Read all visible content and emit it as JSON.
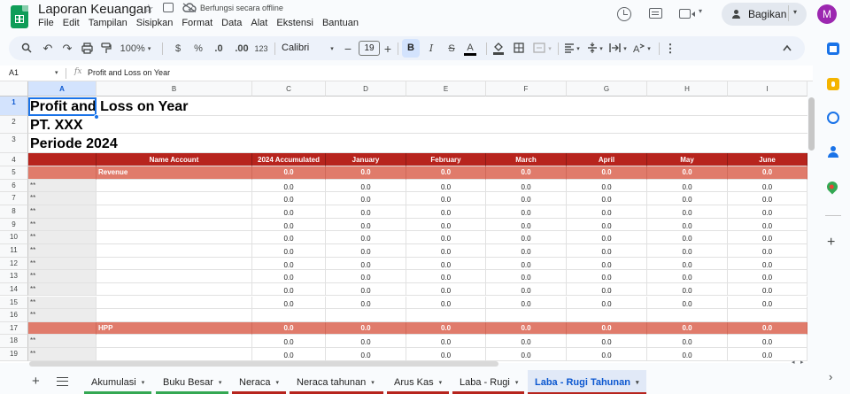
{
  "app": {
    "doc_title": "Laporan Keuangan",
    "offline_status": "Berfungsi secara offline",
    "menu": [
      "File",
      "Edit",
      "Tampilan",
      "Sisipkan",
      "Format",
      "Data",
      "Alat",
      "Ekstensi",
      "Bantuan"
    ],
    "share_label": "Bagikan",
    "avatar_letter": "M"
  },
  "toolbar": {
    "zoom": "100%",
    "currency": "$",
    "percent": "%",
    "dec_decrease": ".0",
    "dec_increase": ".00",
    "number_format": "123",
    "font": "Calibri",
    "font_size": "19",
    "bold": "B",
    "italic": "I",
    "strike": "S",
    "text_color": "A"
  },
  "formula_bar": {
    "cell_ref": "A1",
    "fx": "fx",
    "value": "Profit and Loss on Year"
  },
  "sheet": {
    "columns": [
      "A",
      "B",
      "C",
      "D",
      "E",
      "F",
      "G",
      "H",
      "I"
    ],
    "rows": [
      "1",
      "2",
      "3",
      "4",
      "5",
      "6",
      "7",
      "8",
      "9",
      "10",
      "11",
      "12",
      "13",
      "14",
      "15",
      "16",
      "17",
      "18",
      "19"
    ],
    "title_lines": [
      "Profit and Loss on Year",
      "PT. XXX",
      "Periode 2024"
    ],
    "header_row": [
      "Name Account",
      "2024 Accumulated",
      "January",
      "February",
      "March",
      "April",
      "May",
      "June"
    ],
    "sections": [
      {
        "name": "Revenue",
        "row": 5
      },
      {
        "name": "HPP",
        "row": 17
      }
    ],
    "marker": "**",
    "zero": "0.0",
    "colors": {
      "header": "#b7241d",
      "section": "#e07b6b",
      "column_a": "#ececec"
    }
  },
  "sheet_tabs": [
    {
      "label": "Akumulasi",
      "color": "#34a853"
    },
    {
      "label": "Buku Besar",
      "color": "#34a853"
    },
    {
      "label": "Neraca",
      "color": "#b7241d"
    },
    {
      "label": "Neraca tahunan",
      "color": "#b7241d"
    },
    {
      "label": "Arus Kas",
      "color": "#b7241d"
    },
    {
      "label": "Laba - Rugi",
      "color": "#b7241d"
    },
    {
      "label": "Laba - Rugi Tahunan",
      "color": "#b7241d",
      "active": true
    }
  ],
  "icons": {
    "title_bar": [
      "star-icon",
      "move-icon",
      "offline-cloud-icon",
      "history-icon",
      "comment-icon",
      "meet-icon",
      "avatar"
    ],
    "toolbar": [
      "search-icon",
      "undo-icon",
      "redo-icon",
      "print-icon",
      "paint-format-icon",
      "minus-icon",
      "plus-icon",
      "fill-color-icon",
      "borders-icon",
      "merge-icon",
      "align-icon",
      "valign-icon",
      "wrap-icon",
      "rotate-icon",
      "more-icon",
      "collapse-icon"
    ],
    "side_panel": [
      "calendar-icon",
      "keep-icon",
      "tasks-icon",
      "contacts-icon",
      "maps-icon",
      "add-icon"
    ]
  }
}
